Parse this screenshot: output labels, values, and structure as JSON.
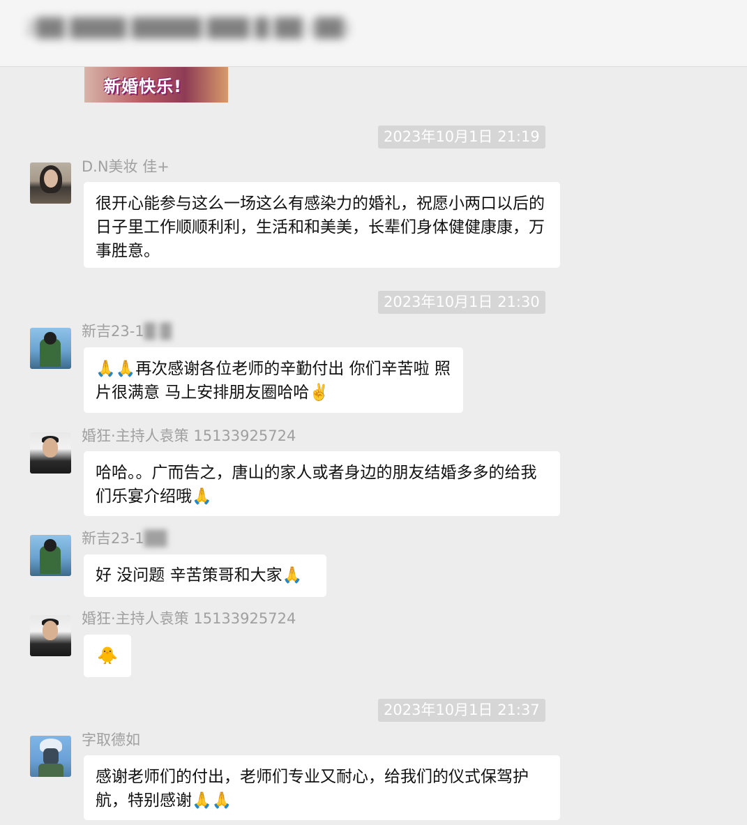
{
  "header": {
    "title": "2██ ████ █████ ███ █ ██ (██)"
  },
  "sticker": {
    "text": "新婚快乐!"
  },
  "timestamps": [
    "2023年10月1日 21:19",
    "2023年10月1日 21:30",
    "2023年10月1日 21:37"
  ],
  "messages": [
    {
      "sender": "D.N美妆  佳+",
      "text": "很开心能参与这么一场这么有感染力的婚礼，祝愿小两口以后的日子里工作顺顺利利，生活和和美美，长辈们身体健健康康，万事胜意。",
      "avatar": "woman-photo-avatar"
    },
    {
      "sender": "新吉23-1",
      "text": "🙏🙏再次感谢各位老师的辛勤付出 你们辛苦啦 照片很满意 马上安排朋友圈哈哈✌️",
      "avatar": "anime-avatar"
    },
    {
      "sender": "婚狂·主持人袁策 15133925724",
      "text": "哈哈。。广而告之，唐山的家人或者身边的朋友结婚多多的给我们乐宴介绍哦🙏",
      "avatar": "man-suit-avatar"
    },
    {
      "sender": "新吉23-1",
      "text": "好 没问题 辛苦策哥和大家🙏",
      "avatar": "anime-avatar"
    },
    {
      "sender": "婚狂·主持人袁策 15133925724",
      "text": "🐥",
      "avatar": "man-suit-avatar"
    },
    {
      "sender": "字取德如",
      "text": "感谢老师们的付出，老师们专业又耐心，给我们的仪式保驾护航，特别感谢🙏🙏",
      "avatar": "ninja-avatar"
    }
  ],
  "colors": {
    "background": "#ededed",
    "bubble": "#ffffff",
    "timestamp_bg": "#d6d6d6",
    "name_text": "#a0a0a0"
  }
}
